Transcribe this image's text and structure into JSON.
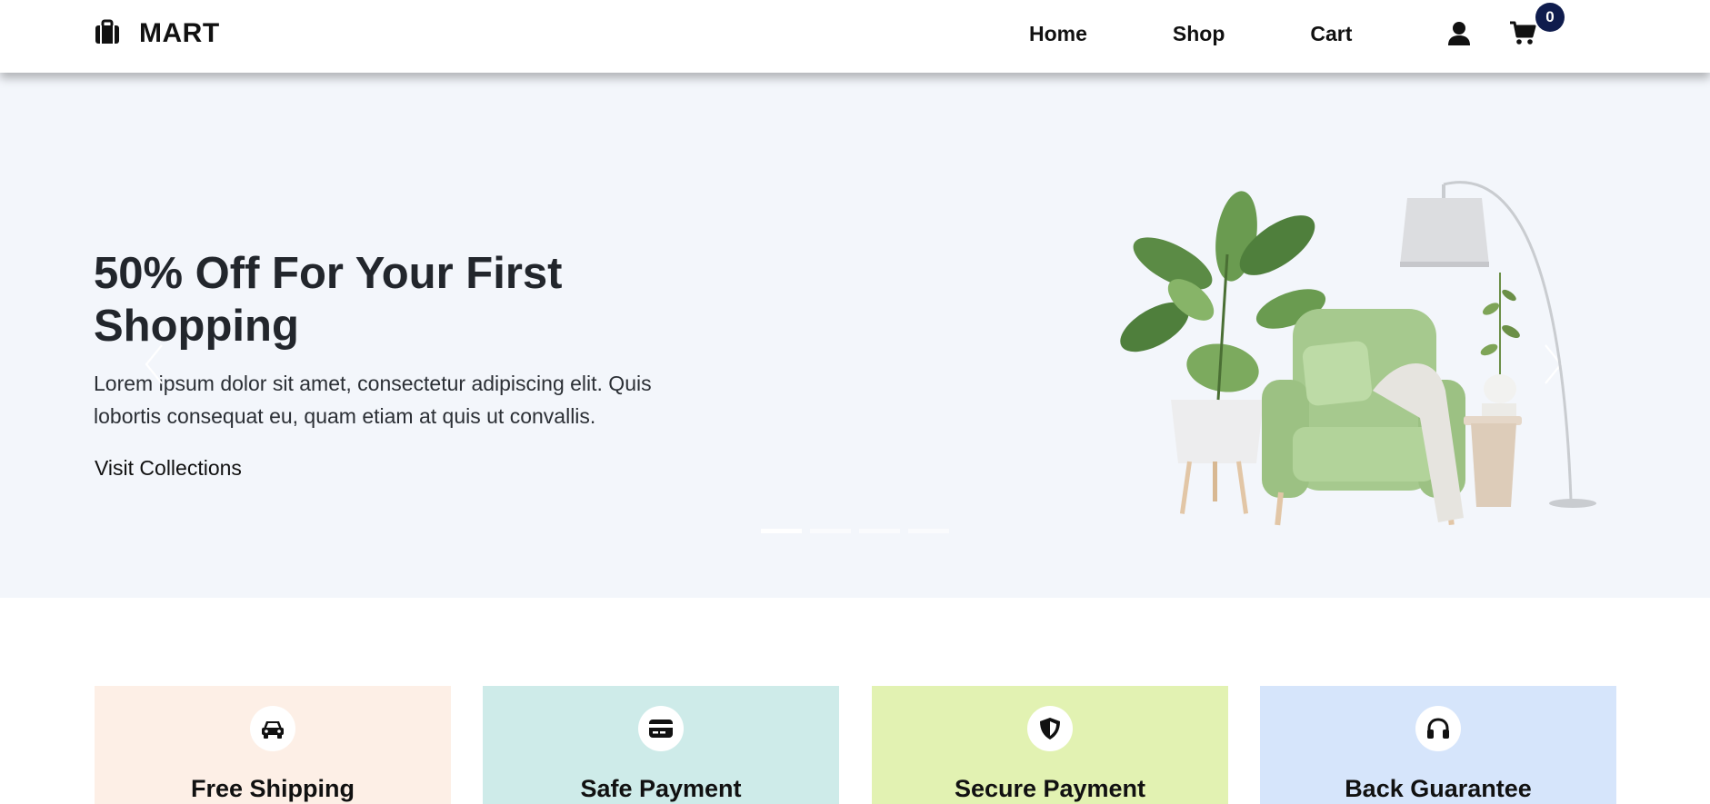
{
  "brand": {
    "name": "MART",
    "icon": "briefcase-icon"
  },
  "nav": {
    "items": [
      {
        "label": "Home"
      },
      {
        "label": "Shop"
      },
      {
        "label": "Cart"
      }
    ],
    "user_icon": "user-icon",
    "cart_icon": "cart-icon",
    "cart_count": "0"
  },
  "hero": {
    "title": "50% Off For Your First Shopping",
    "text": "Lorem ipsum dolor sit amet, consectetur adipiscing elit. Quis lobortis consequat eu, quam etiam at quis ut convallis.",
    "button_label": "Visit Collections",
    "slides_total": 4,
    "active_slide": 1
  },
  "features": [
    {
      "title": "Free Shipping",
      "icon": "car-icon",
      "color": "#fdefe6"
    },
    {
      "title": "Safe Payment",
      "icon": "credit-card-icon",
      "color": "#ceebe9"
    },
    {
      "title": "Secure Payment",
      "icon": "shield-icon",
      "color": "#e2f2b2"
    },
    {
      "title": "Back Guarantee",
      "icon": "headphones-icon",
      "color": "#d6e5fb"
    }
  ],
  "colors": {
    "accent": "#0f1c4d",
    "hero_bg": "#f3f6fb",
    "text": "#22262c"
  }
}
